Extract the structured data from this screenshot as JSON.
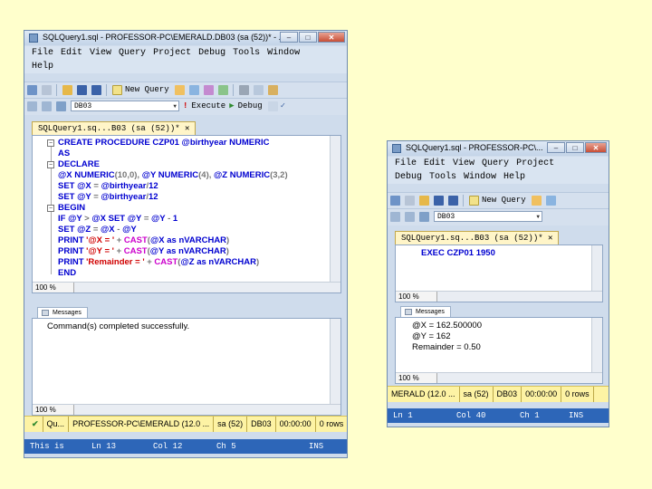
{
  "left": {
    "title": "SQLQuery1.sql - PROFESSOR-PC\\EMERALD.DB03 (sa (52))* - ...",
    "menu": [
      "File",
      "Edit",
      "View",
      "Query",
      "Project",
      "Debug",
      "Tools",
      "Window",
      "Help"
    ],
    "toolbar1": {
      "new_query": "New Query"
    },
    "toolbar2": {
      "db": "DB03",
      "execute": "Execute",
      "debug": "Debug"
    },
    "tab": "SQLQuery1.sq...B03 (sa (52))*",
    "code": [
      {
        "parts": [
          [
            "kw",
            "CREATE PROCEDURE "
          ],
          [
            "",
            "CZP01 @birthyear "
          ],
          [
            "kw",
            "NUMERIC"
          ]
        ]
      },
      {
        "parts": [
          [
            "kw",
            "AS"
          ]
        ]
      },
      {
        "parts": [
          [
            "kw",
            "DECLARE"
          ]
        ]
      },
      {
        "parts": [
          [
            "",
            "@X "
          ],
          [
            "kw",
            "NUMERIC"
          ],
          [
            "gray",
            "(10,0), "
          ],
          [
            "",
            "@Y "
          ],
          [
            "kw",
            "NUMERIC"
          ],
          [
            "gray",
            "(4), "
          ],
          [
            "",
            "@Z "
          ],
          [
            "kw",
            "NUMERIC"
          ],
          [
            "gray",
            "(3,2)"
          ]
        ]
      },
      {
        "parts": [
          [
            "kw",
            "SET "
          ],
          [
            "",
            "@X "
          ],
          [
            "gray",
            "= "
          ],
          [
            "",
            "@birthyear"
          ],
          [
            "gray",
            "/"
          ],
          [
            "",
            "12"
          ]
        ]
      },
      {
        "parts": [
          [
            "kw",
            "SET "
          ],
          [
            "",
            "@Y "
          ],
          [
            "gray",
            "= "
          ],
          [
            "",
            "@birthyear"
          ],
          [
            "gray",
            "/"
          ],
          [
            "",
            "12"
          ]
        ]
      },
      {
        "parts": [
          [
            "kw",
            "BEGIN"
          ]
        ]
      },
      {
        "parts": [
          [
            "kw",
            "IF "
          ],
          [
            "",
            "@Y "
          ],
          [
            "gray",
            "> "
          ],
          [
            "",
            "@X "
          ],
          [
            "kw",
            "SET "
          ],
          [
            "",
            "@Y "
          ],
          [
            "gray",
            "= "
          ],
          [
            "",
            "@Y "
          ],
          [
            "gray",
            "- "
          ],
          [
            "",
            "1"
          ]
        ]
      },
      {
        "parts": [
          [
            "kw",
            "SET "
          ],
          [
            "",
            "@Z "
          ],
          [
            "gray",
            "= "
          ],
          [
            "",
            "@X "
          ],
          [
            "gray",
            "- "
          ],
          [
            "",
            "@Y"
          ]
        ]
      },
      {
        "parts": [
          [
            "kw",
            "PRINT "
          ],
          [
            "str",
            "'@X = ' "
          ],
          [
            "gray",
            "+ "
          ],
          [
            "fn",
            "CAST"
          ],
          [
            "gray",
            "("
          ],
          [
            "",
            "@X "
          ],
          [
            "kw",
            "as "
          ],
          [
            "",
            "nVARCHAR"
          ],
          [
            "gray",
            ")"
          ]
        ]
      },
      {
        "parts": [
          [
            "kw",
            "PRINT "
          ],
          [
            "str",
            "'@Y = ' "
          ],
          [
            "gray",
            "+ "
          ],
          [
            "fn",
            "CAST"
          ],
          [
            "gray",
            "("
          ],
          [
            "",
            "@Y "
          ],
          [
            "kw",
            "as "
          ],
          [
            "",
            "nVARCHAR"
          ],
          [
            "gray",
            ")"
          ]
        ]
      },
      {
        "parts": [
          [
            "kw",
            "PRINT "
          ],
          [
            "str",
            "'Remainder = ' "
          ],
          [
            "gray",
            "+ "
          ],
          [
            "fn",
            "CAST"
          ],
          [
            "gray",
            "("
          ],
          [
            "",
            "@Z "
          ],
          [
            "kw",
            "as "
          ],
          [
            "",
            "nVARCHAR"
          ],
          [
            "gray",
            ")"
          ]
        ]
      },
      {
        "parts": [
          [
            "kw",
            "END"
          ]
        ]
      }
    ],
    "zoom_top": "100 %",
    "messages_tab": "Messages",
    "messages": [
      "Command(s) completed successfully."
    ],
    "zoom_bottom": "100 %",
    "status": [
      "Qu...",
      "PROFESSOR-PC\\EMERALD (12.0 ...",
      "sa (52)",
      "DB03",
      "00:00:00",
      "0 rows"
    ],
    "bottom": [
      "This is",
      "Ln 13",
      "Col 12",
      "Ch 5",
      "INS"
    ]
  },
  "right": {
    "title": "SQLQuery1.sql - PROFESSOR-PC\\...",
    "menu_row1": [
      "File",
      "Edit",
      "View",
      "Query",
      "Project"
    ],
    "menu_row2": [
      "Debug",
      "Tools",
      "Window",
      "Help"
    ],
    "toolbar1": {
      "new_query": "New Query"
    },
    "toolbar2": {
      "db": "DB03"
    },
    "tab": "SQLQuery1.sq...B03 (sa (52))*",
    "code": "EXEC CZP01 1950",
    "zoom_top": "100 %",
    "messages_tab": "Messages",
    "messages": [
      "@X = 162.500000",
      "@Y = 162",
      "Remainder = 0.50"
    ],
    "zoom_bottom": "100 %",
    "status": [
      "MERALD (12.0 ...",
      "sa (52)",
      "DB03",
      "00:00:00",
      "0 rows"
    ],
    "bottom": [
      "Ln 1",
      "Col 40",
      "Ch 1",
      "INS"
    ]
  },
  "colors": {
    "page_bg": "#ffffcc",
    "keyword": "#0000d0",
    "string": "#d00000",
    "function": "#cc00cc",
    "statusbar": "#fdf3a4",
    "bottombar": "#2d66b8"
  }
}
